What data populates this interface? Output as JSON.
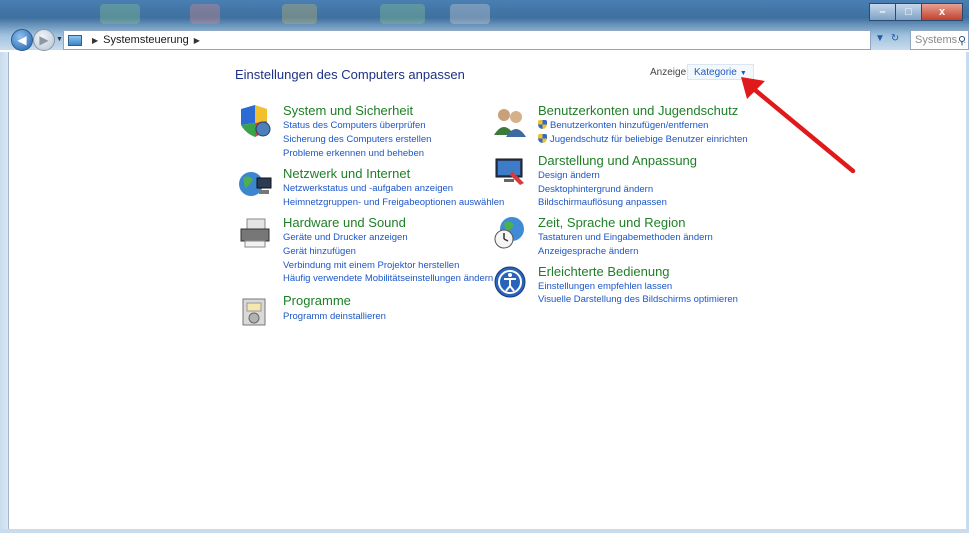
{
  "window": {
    "controls": {
      "minimize": "–",
      "maximize": "□",
      "close": "x"
    }
  },
  "address_bar": {
    "breadcrumb": "Systemsteuerung",
    "search_placeholder": "Systems..."
  },
  "main": {
    "title": "Einstellungen des Computers anpassen",
    "view_label": "Anzeige:",
    "view_value": "Kategorie"
  },
  "categories_left": [
    {
      "title": "System und Sicherheit",
      "icon": "system-security-icon",
      "links": [
        "Status des Computers überprüfen",
        "Sicherung des Computers erstellen",
        "Probleme erkennen und beheben"
      ]
    },
    {
      "title": "Netzwerk und Internet",
      "icon": "network-internet-icon",
      "links": [
        "Netzwerkstatus und -aufgaben anzeigen",
        "Heimnetzgruppen- und Freigabeoptionen auswählen"
      ]
    },
    {
      "title": "Hardware und Sound",
      "icon": "hardware-sound-icon",
      "links": [
        "Geräte und Drucker anzeigen",
        "Gerät hinzufügen",
        "Verbindung mit einem Projektor herstellen",
        "Häufig verwendete Mobilitätseinstellungen ändern"
      ]
    },
    {
      "title": "Programme",
      "icon": "programs-icon",
      "links": [
        "Programm deinstallieren"
      ]
    }
  ],
  "categories_right": [
    {
      "title": "Benutzerkonten und Jugendschutz",
      "icon": "user-accounts-icon",
      "links": [
        "Benutzerkonten hinzufügen/entfernen",
        "Jugendschutz für beliebige Benutzer einrichten"
      ]
    },
    {
      "title": "Darstellung und Anpassung",
      "icon": "appearance-icon",
      "links": [
        "Design ändern",
        "Desktophintergrund ändern",
        "Bildschirmauflösung anpassen"
      ]
    },
    {
      "title": "Zeit, Sprache und Region",
      "icon": "clock-language-region-icon",
      "links": [
        "Tastaturen und Eingabemethoden ändern",
        "Anzeigesprache ändern"
      ]
    },
    {
      "title": "Erleichterte Bedienung",
      "icon": "ease-of-access-icon",
      "links": [
        "Einstellungen empfehlen lassen",
        "Visuelle Darstellung des Bildschirms optimieren"
      ]
    }
  ],
  "colors": {
    "title_blue": "#1e3287",
    "category_green": "#1e7f27",
    "link_blue": "#1b56c9",
    "annotation_red": "#e0191b"
  }
}
